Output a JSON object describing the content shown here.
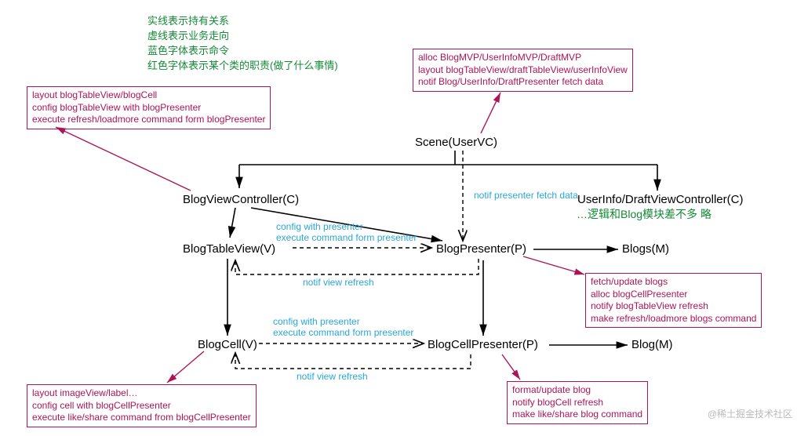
{
  "legend": {
    "l1": "实线表示持有关系",
    "l2": "虚线表示业务走向",
    "l3": "蓝色字体表示命令",
    "l4": "红色字体表示某个类的职责(做了什么事情)"
  },
  "nodes": {
    "scene": "Scene(UserVC)",
    "blogVC": "BlogViewController(C)",
    "blogTV": "BlogTableView(V)",
    "blogCell": "BlogCell(V)",
    "blogPresenter": "BlogPresenter(P)",
    "blogCellPresenter": "BlogCellPresenter(P)",
    "blogs": "Blogs(M)",
    "blog": "Blog(M)",
    "userInfoVC": "UserInfo/DraftViewController(C)",
    "userInfoSub": "…逻辑和Blog模块差不多 略"
  },
  "cmds": {
    "notifPresenter": "notif presenter fetch data",
    "cfgWithPresenter": "config with presenter",
    "execFromPresenter": "execute command form presenter",
    "notifViewRefresh": "notif view refresh"
  },
  "resps": {
    "scene": {
      "r1": "alloc BlogMVP/UserInfoMVP/DraftMVP",
      "r2": "layout blogTableView/draftTableView/userInfoView",
      "r3": "notif Blog/UserInfo/DraftPresenter fetch data"
    },
    "blogVC": {
      "r1": "layout blogTableView/blogCell",
      "r2": "config blogTableView with blogPresenter",
      "r3": "execute refresh/loadmore command form blogPresenter"
    },
    "blogsM": {
      "r1": "fetch/update blogs",
      "r2": "alloc blogCellPresenter",
      "r3": "notify blogTableView refresh",
      "r4": "make refresh/loadmore blogs command"
    },
    "blogCell": {
      "r1": "layout imageView/label…",
      "r2": "config cell with blogCellPresenter",
      "r3": "execute like/share command from blogCellPresenter"
    },
    "blogCellP": {
      "r1": "format/update blog",
      "r2": "notify blogCell refresh",
      "r3": "make like/share blog command"
    }
  },
  "watermark": "@稀土掘金技术社区"
}
